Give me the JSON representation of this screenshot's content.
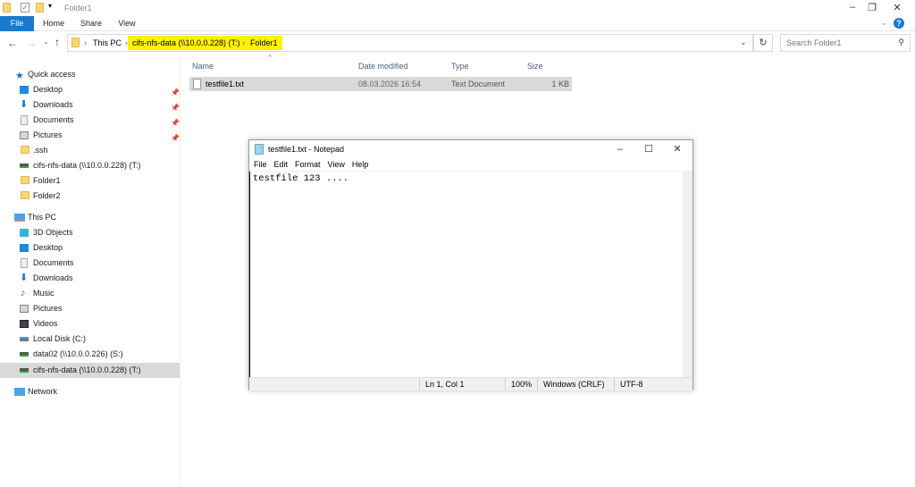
{
  "window": {
    "title": "Folder1"
  },
  "ribbon": {
    "tabs": [
      "File",
      "Home",
      "Share",
      "View"
    ]
  },
  "address": {
    "segments": [
      "This PC",
      "cifs-nfs-data (\\\\10.0.0.228) (T:)",
      "Folder1"
    ]
  },
  "search": {
    "placeholder": "Search Folder1"
  },
  "nav": {
    "quick_access": "Quick access",
    "quick_items": [
      {
        "label": "Desktop",
        "pinned": true
      },
      {
        "label": "Downloads",
        "pinned": true
      },
      {
        "label": "Documents",
        "pinned": true
      },
      {
        "label": "Pictures",
        "pinned": true
      },
      {
        "label": ".ssh"
      },
      {
        "label": "cifs-nfs-data (\\\\10.0.0.228) (T:)"
      },
      {
        "label": "Folder1"
      },
      {
        "label": "Folder2"
      }
    ],
    "this_pc": "This PC",
    "pc_items": [
      "3D Objects",
      "Desktop",
      "Documents",
      "Downloads",
      "Music",
      "Pictures",
      "Videos",
      "Local Disk (C:)",
      "data02 (\\\\10.0.0.226) (S:)",
      "cifs-nfs-data (\\\\10.0.0.228) (T:)"
    ],
    "network": "Network"
  },
  "files": {
    "columns": [
      "Name",
      "Date modified",
      "Type",
      "Size"
    ],
    "rows": [
      {
        "name": "testfile1.txt",
        "date": "08.03.2026 16:54",
        "type": "Text Document",
        "size": "1 KB"
      }
    ]
  },
  "notepad": {
    "title": "testfile1.txt - Notepad",
    "menu": [
      "File",
      "Edit",
      "Format",
      "View",
      "Help"
    ],
    "content": "testfile 123 ....",
    "status": {
      "position": "Ln 1, Col 1",
      "zoom": "100%",
      "line_ending": "Windows (CRLF)",
      "encoding": "UTF-8"
    }
  },
  "colors": {
    "highlight": "#fff200",
    "file_tab": "#1979ca",
    "selection": "#d9d9d9"
  }
}
